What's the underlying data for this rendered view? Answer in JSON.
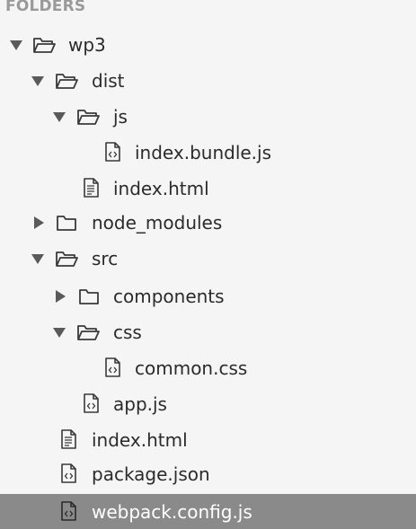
{
  "sidebar": {
    "header": "FOLDERS",
    "items": [
      {
        "label": "wp3",
        "type": "folder",
        "state": "expanded",
        "depth": 0
      },
      {
        "label": "dist",
        "type": "folder",
        "state": "expanded",
        "depth": 1
      },
      {
        "label": "js",
        "type": "folder",
        "state": "expanded",
        "depth": 2
      },
      {
        "label": "index.bundle.js",
        "type": "code-file",
        "depth": 3
      },
      {
        "label": "index.html",
        "type": "text-file",
        "depth": 2
      },
      {
        "label": "node_modules",
        "type": "folder",
        "state": "collapsed",
        "depth": 1
      },
      {
        "label": "src",
        "type": "folder",
        "state": "expanded",
        "depth": 1
      },
      {
        "label": "components",
        "type": "folder",
        "state": "collapsed",
        "depth": 2
      },
      {
        "label": "css",
        "type": "folder",
        "state": "expanded",
        "depth": 2
      },
      {
        "label": "common.css",
        "type": "code-file",
        "depth": 3
      },
      {
        "label": "app.js",
        "type": "code-file",
        "depth": 2
      },
      {
        "label": "index.html",
        "type": "text-file",
        "depth": 1
      },
      {
        "label": "package.json",
        "type": "code-file",
        "depth": 1
      },
      {
        "label": "webpack.config.js",
        "type": "code-file",
        "depth": 1,
        "selected": true
      }
    ]
  },
  "colors": {
    "background": "#f5f5f5",
    "header_text": "#9a9a9a",
    "selection": "#8a8a8a",
    "text": "#2b2b2b",
    "icon_stroke": "#3a3a3a"
  }
}
